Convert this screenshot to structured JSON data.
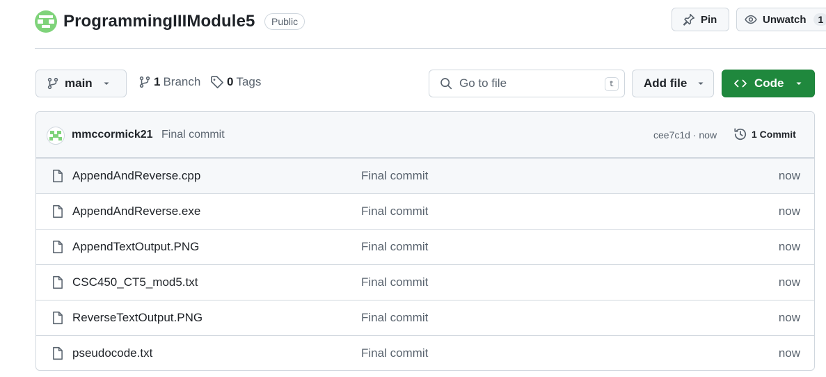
{
  "repo": {
    "name": "ProgrammingIIIModule5",
    "visibility": "Public",
    "pin_label": "Pin",
    "watch_label": "Unwatch",
    "watch_count": "1"
  },
  "toolbar": {
    "branch": "main",
    "branches_count": "1",
    "branches_label": "Branch",
    "tags_count": "0",
    "tags_label": "Tags",
    "search_placeholder": "Go to file",
    "search_shortcut": "t",
    "add_file_label": "Add file",
    "code_label": "Code"
  },
  "latest_commit": {
    "author": "mmccormick21",
    "message": "Final commit",
    "sha_time": "cee7c1d · now",
    "commits_label": "1 Commit"
  },
  "files": [
    {
      "name": "AppendAndReverse.cpp",
      "commit": "Final commit",
      "age": "now"
    },
    {
      "name": "AppendAndReverse.exe",
      "commit": "Final commit",
      "age": "now"
    },
    {
      "name": "AppendTextOutput.PNG",
      "commit": "Final commit",
      "age": "now"
    },
    {
      "name": "CSC450_CT5_mod5.txt",
      "commit": "Final commit",
      "age": "now"
    },
    {
      "name": "ReverseTextOutput.PNG",
      "commit": "Final commit",
      "age": "now"
    },
    {
      "name": "pseudocode.txt",
      "commit": "Final commit",
      "age": "now"
    }
  ],
  "colors": {
    "primary_button": "#1f883d",
    "border": "#d0d7de",
    "muted_text": "#59636e",
    "identicon": "#7fd37a"
  },
  "icons": [
    "identicon-avatar",
    "pin-icon",
    "eye-icon",
    "branch-icon",
    "tag-icon",
    "search-icon",
    "code-icon",
    "history-icon",
    "file-icon",
    "caret-down-icon"
  ]
}
